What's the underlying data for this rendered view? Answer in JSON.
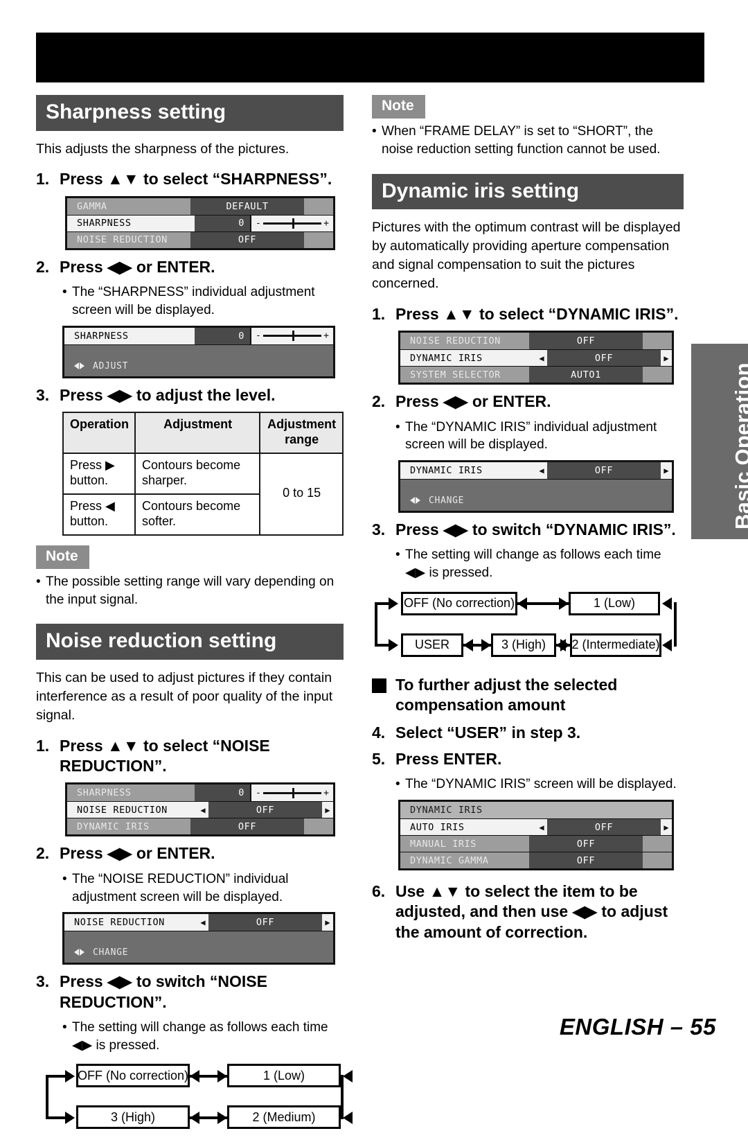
{
  "page": {
    "footer": "ENGLISH – 55",
    "side_tab": "Basic Operation"
  },
  "sharpness": {
    "heading": "Sharpness setting",
    "intro": "This adjusts the sharpness of the pictures.",
    "step1_num": "1.",
    "step1_text": "Press ▲▼ to select “SHARPNESS”.",
    "menu1": {
      "rows": [
        {
          "label": "GAMMA",
          "value": "DEFAULT",
          "state": "dim",
          "type": "value"
        },
        {
          "label": "SHARPNESS",
          "value": "0",
          "state": "sel",
          "type": "slider"
        },
        {
          "label": "NOISE REDUCTION",
          "value": "OFF",
          "state": "dim",
          "type": "value"
        }
      ]
    },
    "step2_num": "2.",
    "step2_text": "Press ◀▶ or ENTER.",
    "step2_bullet": "The “SHARPNESS” individual adjustment screen will be displayed.",
    "menu2": {
      "row": {
        "label": "SHARPNESS",
        "value": "0",
        "state": "sel",
        "type": "slider"
      },
      "hint": "ADJUST"
    },
    "step3_num": "3.",
    "step3_text": "Press ◀▶ to adjust the level.",
    "table": {
      "headers": [
        "Operation",
        "Adjustment",
        "Adjustment range"
      ],
      "rows": [
        {
          "operation": "Press ▶ button.",
          "adjustment": "Contours become sharper."
        },
        {
          "operation": "Press ◀ button.",
          "adjustment": "Contours become softer."
        }
      ],
      "range": "0 to 15"
    },
    "note_tag": "Note",
    "note_text": "The possible setting range will vary depending on the input signal."
  },
  "noise_reduction": {
    "heading": "Noise reduction setting",
    "intro": "This can be used to adjust pictures if they contain interference as a result of poor quality of the input signal.",
    "step1_num": "1.",
    "step1_text": "Press ▲▼ to select “NOISE REDUCTION”.",
    "menu1": {
      "rows": [
        {
          "label": "SHARPNESS",
          "value": "0",
          "state": "dim",
          "type": "slider"
        },
        {
          "label": "NOISE REDUCTION",
          "value": "OFF",
          "state": "sel",
          "type": "caret"
        },
        {
          "label": "DYNAMIC IRIS",
          "value": "OFF",
          "state": "dim",
          "type": "value"
        }
      ]
    },
    "step2_num": "2.",
    "step2_text": "Press ◀▶ or ENTER.",
    "step2_bullet": "The “NOISE REDUCTION” individual adjustment screen will be displayed.",
    "menu2": {
      "row": {
        "label": "NOISE REDUCTION",
        "value": "OFF",
        "state": "sel",
        "type": "caret"
      },
      "hint": "CHANGE"
    },
    "step3_num": "3.",
    "step3_text": "Press ◀▶ to switch “NOISE REDUCTION”.",
    "step3_bullet": "The setting will change as follows each time ◀▶ is pressed.",
    "flow": {
      "boxes": [
        "OFF (No correction)",
        "1 (Low)",
        "3 (High)",
        "2 (Medium)"
      ]
    }
  },
  "note_frame_delay": {
    "tag": "Note",
    "text": "When “FRAME DELAY” is set to “SHORT”, the noise reduction setting function cannot be used."
  },
  "dynamic_iris": {
    "heading": "Dynamic iris setting",
    "intro": "Pictures with the optimum contrast will be displayed by automatically providing aperture compensation and signal compensation to suit the pictures concerned.",
    "step1_num": "1.",
    "step1_text": "Press ▲▼ to select “DYNAMIC IRIS”.",
    "menu1": {
      "rows": [
        {
          "label": "NOISE REDUCTION",
          "value": "OFF",
          "state": "dim",
          "type": "value"
        },
        {
          "label": "DYNAMIC IRIS",
          "value": "OFF",
          "state": "sel",
          "type": "caret"
        },
        {
          "label": "SYSTEM SELECTOR",
          "value": "AUTO1",
          "state": "dim",
          "type": "value"
        }
      ]
    },
    "step2_num": "2.",
    "step2_text": "Press ◀▶ or ENTER.",
    "step2_bullet": "The “DYNAMIC IRIS” individual adjustment screen will be displayed.",
    "menu2": {
      "row": {
        "label": "DYNAMIC IRIS",
        "value": "OFF",
        "state": "sel",
        "type": "caret"
      },
      "hint": "CHANGE"
    },
    "step3_num": "3.",
    "step3_text": "Press ◀▶ to switch “DYNAMIC IRIS”.",
    "step3_bullet": "The setting will change as follows each time ◀▶ is pressed.",
    "flow": {
      "boxes": [
        "OFF (No correction)",
        "1 (Low)",
        "USER",
        "3 (High)",
        "2 (Intermediate)"
      ]
    },
    "square_heading": "To further adjust the selected compensation amount",
    "step4_num": "4.",
    "step4_text": "Select “USER” in step 3.",
    "step5_num": "5.",
    "step5_text": "Press ENTER.",
    "step5_bullet": "The “DYNAMIC IRIS” screen will be displayed.",
    "menu3": {
      "title": "DYNAMIC IRIS",
      "rows": [
        {
          "label": "AUTO IRIS",
          "value": "OFF",
          "state": "sel",
          "type": "caret"
        },
        {
          "label": "MANUAL IRIS",
          "value": "OFF",
          "state": "dim",
          "type": "value"
        },
        {
          "label": "DYNAMIC GAMMA",
          "value": "OFF",
          "state": "dim",
          "type": "value"
        }
      ]
    },
    "step6_num": "6.",
    "step6_text": "Use ▲▼ to select the item to be adjusted, and then use ◀▶ to adjust the amount of correction."
  }
}
